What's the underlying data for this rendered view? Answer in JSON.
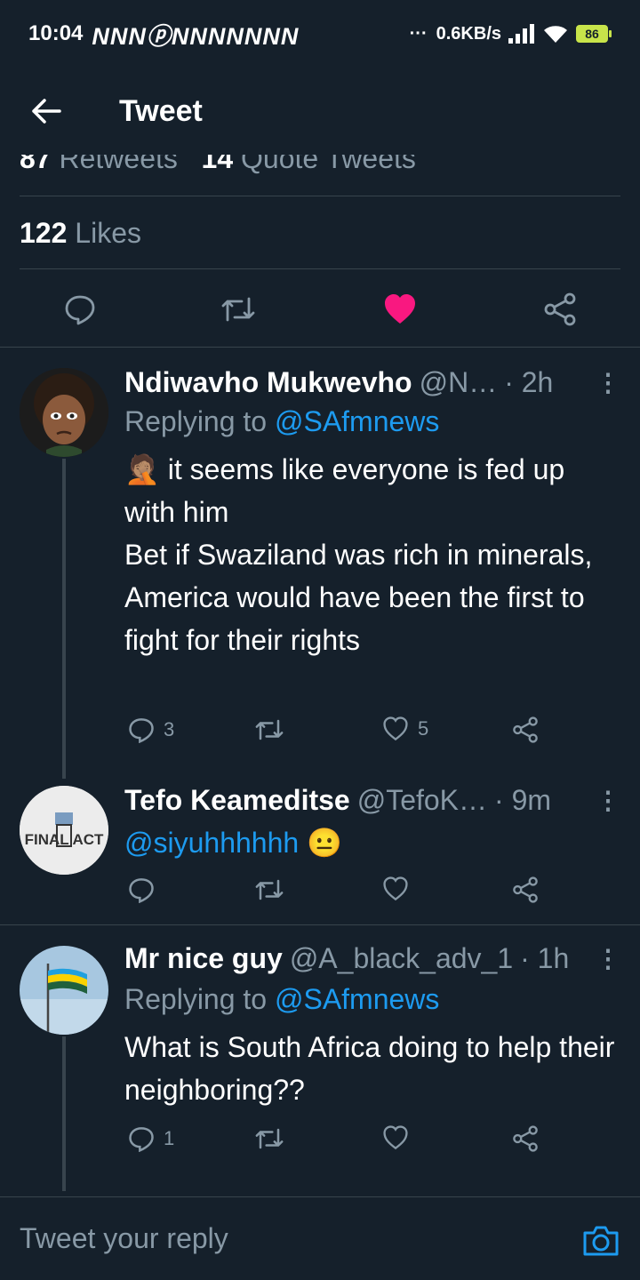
{
  "status_bar": {
    "time": "10:04",
    "notification_icons": "NNNⓟNNNNNNN",
    "dots": "···",
    "network_speed": "0.6KB/s",
    "battery": "86"
  },
  "header": {
    "title": "Tweet"
  },
  "stats": {
    "retweets_count": "87",
    "retweets_label": "Retweets",
    "quotes_count": "14",
    "quotes_label": "Quote Tweets",
    "likes_count": "122",
    "likes_label": "Likes"
  },
  "colors": {
    "background": "#15202b",
    "accent": "#1d9bf0",
    "like": "#f91880",
    "muted": "#8899a6",
    "divider": "#38444d"
  },
  "replies": [
    {
      "name": "Ndiwavho Mukwevho",
      "handle": "@N…",
      "time": "· 2h",
      "replying_prefix": "Replying to",
      "replying_to": "@SAfmnews",
      "emoji": "🤦🏽",
      "text": "it seems like everyone is fed up with him\nBet if Swaziland was rich in minerals, America would have been the first to fight for their rights",
      "reply_count": "3",
      "retweet_count": "",
      "like_count": "5"
    },
    {
      "name": "Tefo Keameditse",
      "handle": "@TefoK…",
      "time": "· 9m",
      "mention": "@siyuhhhhhh",
      "emoji": "😐",
      "avatar_text": "FINAL ACT",
      "reply_count": "",
      "retweet_count": "",
      "like_count": ""
    },
    {
      "name": "Mr nice guy",
      "handle": "@A_black_adv_1",
      "time": "· 1h",
      "replying_prefix": "Replying to",
      "replying_to": "@SAfmnews",
      "text": "What is South Africa doing to help their neighboring??",
      "reply_count": "1",
      "retweet_count": "",
      "like_count": ""
    }
  ],
  "composer": {
    "placeholder": "Tweet your reply"
  }
}
